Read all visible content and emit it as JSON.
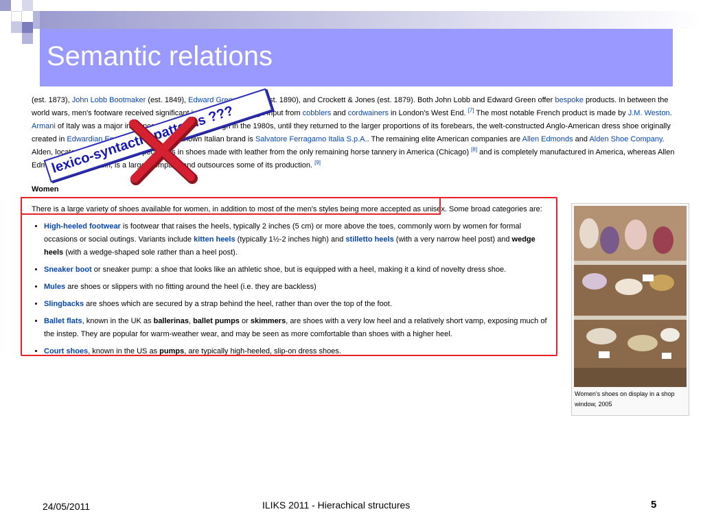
{
  "slide": {
    "title": "Semantic relations",
    "footer_date": "24/05/2011",
    "footer_title": "ILIKS 2011 - Hierachical structures",
    "page_number": "5"
  },
  "overlay": {
    "label": "lexico-syntactic patterns ???"
  },
  "wiki": {
    "p1": [
      {
        "t": "(est. 1873), "
      },
      {
        "t": "John Lobb Bootmaker",
        "link": true
      },
      {
        "t": " (est. 1849), "
      },
      {
        "t": "Edward Green Shoes",
        "link": true
      },
      {
        "t": " (est. 1890), and Crockett & Jones (est. 1879). Both John Lobb and Edward Green offer "
      },
      {
        "t": "bespoke",
        "link": true
      },
      {
        "t": " products. In between the world wars, men's footware received significant innovation and design input from "
      },
      {
        "t": "cobblers",
        "link": true
      },
      {
        "t": " and "
      },
      {
        "t": "cordwainers",
        "link": true
      },
      {
        "t": " in London's West End. "
      },
      {
        "t": "[7]",
        "sup": true
      },
      {
        "t": " The most notable French product is made by "
      },
      {
        "t": "J.M. Weston",
        "link": true
      },
      {
        "t": ". "
      },
      {
        "t": "Armani",
        "link": true
      },
      {
        "t": " of Italy was a major influence on men's shoe design in the 1980s, until they returned to the larger proportions of its forebears, the welt-constructed Anglo-American dress shoe originally created in "
      },
      {
        "t": "Edwardian England",
        "link": true
      },
      {
        "t": ". Another well-known Italian brand is "
      },
      {
        "t": "Salvatore Ferragamo Italia S.p.A.",
        "link": true
      },
      {
        "t": ". The remaining elite American companies are "
      },
      {
        "t": "Allen Edmonds",
        "link": true
      },
      {
        "t": " and "
      },
      {
        "t": "Alden Shoe Company",
        "link": true
      },
      {
        "t": ". Alden, located in New England, specializes in shoes made with leather from the only remaining horse tannery in America (Chicago) "
      },
      {
        "t": "[8]",
        "sup": true
      },
      {
        "t": " and is completely manufactured in America, whereas Allen Edmonds, of Wisconsin, is a larger company and outsources some of its production. "
      },
      {
        "t": "[9]",
        "sup": true
      }
    ],
    "subheading": "Women",
    "lead": [
      {
        "t": "There is a large variety of shoes available for women, in addition to most of the men's styles being more accepted as unisex. "
      },
      {
        "t": "Some broad categories are:"
      }
    ],
    "categories": [
      [
        {
          "t": "High-heeled footwear",
          "link": true,
          "bold": true
        },
        {
          "t": " is footwear that raises the heels, typically 2 inches (5 cm) or more above the toes, commonly worn by women for formal occasions or social outings. Variants include "
        },
        {
          "t": "kitten heels",
          "link": true,
          "bold": true
        },
        {
          "t": " (typically 1½-2 inches high) and "
        },
        {
          "t": "stilletto heels",
          "link": true,
          "bold": true
        },
        {
          "t": " (with a very narrow heel post) and "
        },
        {
          "t": "wedge heels",
          "bold": true
        },
        {
          "t": " (with a wedge-shaped sole rather than a heel post)."
        }
      ],
      [
        {
          "t": "Sneaker boot",
          "link": true,
          "bold": true
        },
        {
          "t": " or sneaker pump: a shoe that looks like an athletic shoe, but is equipped with a heel, making it a kind of novelty dress shoe."
        }
      ],
      [
        {
          "t": "Mules",
          "link": true,
          "bold": true
        },
        {
          "t": " are shoes or slippers with no fitting around the heel (i.e. they are backless)"
        }
      ],
      [
        {
          "t": "Slingbacks",
          "link": true,
          "bold": true
        },
        {
          "t": " are shoes which are secured by a strap behind the heel, rather than over the top of the foot."
        }
      ],
      [
        {
          "t": "Ballet flats",
          "link": true,
          "bold": true
        },
        {
          "t": ", known in the UK as "
        },
        {
          "t": "ballerinas",
          "bold": true
        },
        {
          "t": ", "
        },
        {
          "t": "ballet pumps",
          "bold": true
        },
        {
          "t": " or "
        },
        {
          "t": "skimmers",
          "bold": true
        },
        {
          "t": ", are shoes with a very low heel and a relatively short vamp, exposing much of the instep. They are popular for warm-weather wear, and may be seen as more comfortable than shoes with a higher heel."
        }
      ],
      [
        {
          "t": "Court shoes",
          "link": true,
          "bold": true
        },
        {
          "t": ", known in the US as "
        },
        {
          "t": "pumps",
          "bold": true
        },
        {
          "t": ", are typically high-heeled, slip-on dress shoes."
        }
      ]
    ],
    "photo_caption": "Women's shoes on display in a shop window, 2005"
  },
  "colors": {
    "title_bar": "#9999ff",
    "link": "#0645ad",
    "highlight_box": "#e8202a",
    "stamp_text": "#1515b5",
    "cross": "#d42030"
  }
}
